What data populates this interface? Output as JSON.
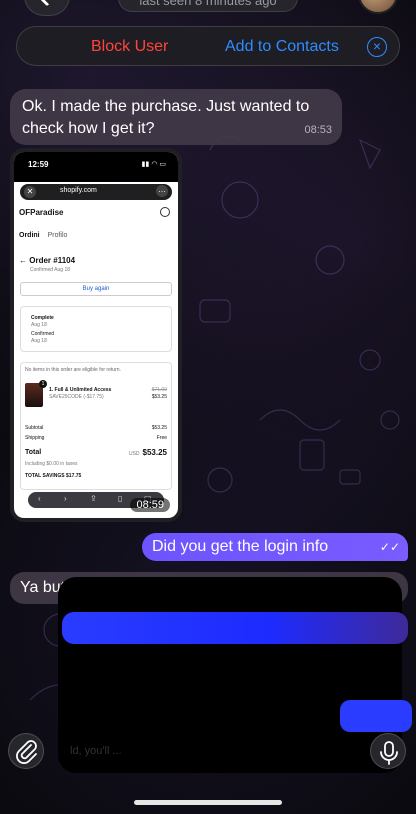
{
  "header": {
    "last_seen": "last seen 8 minutes ago"
  },
  "action_bar": {
    "block_label": "Block User",
    "add_label": "Add to Contacts"
  },
  "messages": {
    "m1_text": "Ok. I made the purchase. Just wanted to check how I get it?",
    "m1_time": "08:53",
    "shot_time": "08:59",
    "out_text": "Did you get the login info",
    "in2_text": "Ya but I don't know where to use it"
  },
  "screenshot": {
    "status_time": "12:59",
    "url": "shopify.com",
    "shop_name": "OFParadise",
    "tab_orders": "Ordini",
    "tab_profile": "Profilo",
    "order_number": "Order #1104",
    "order_confirmed": "Confirmed Aug 18",
    "buy_again": "Buy again",
    "status_complete": "Complete",
    "status_complete_date": "Aug 18",
    "status_confirmed": "Confirmed",
    "status_confirmed_date": "Aug 18",
    "return_note": "No items in this order are eligible for return.",
    "item_qty": "1",
    "item_name": "1. Full & Unlimited Access",
    "item_code": "SAVE25CODE (-$17.75)",
    "item_old_price": "$71.00",
    "item_price": "$53.25",
    "subtotal_label": "Subtotal",
    "subtotal_value": "$53.25",
    "shipping_label": "Shipping",
    "shipping_value": "Free",
    "total_label": "Total",
    "total_currency": "USD",
    "total_value": "$53.25",
    "taxes_note": "Including $0.00 in taxes",
    "savings": "TOTAL SAVINGS $17.75"
  },
  "partial_text": "ld, you'll ..."
}
